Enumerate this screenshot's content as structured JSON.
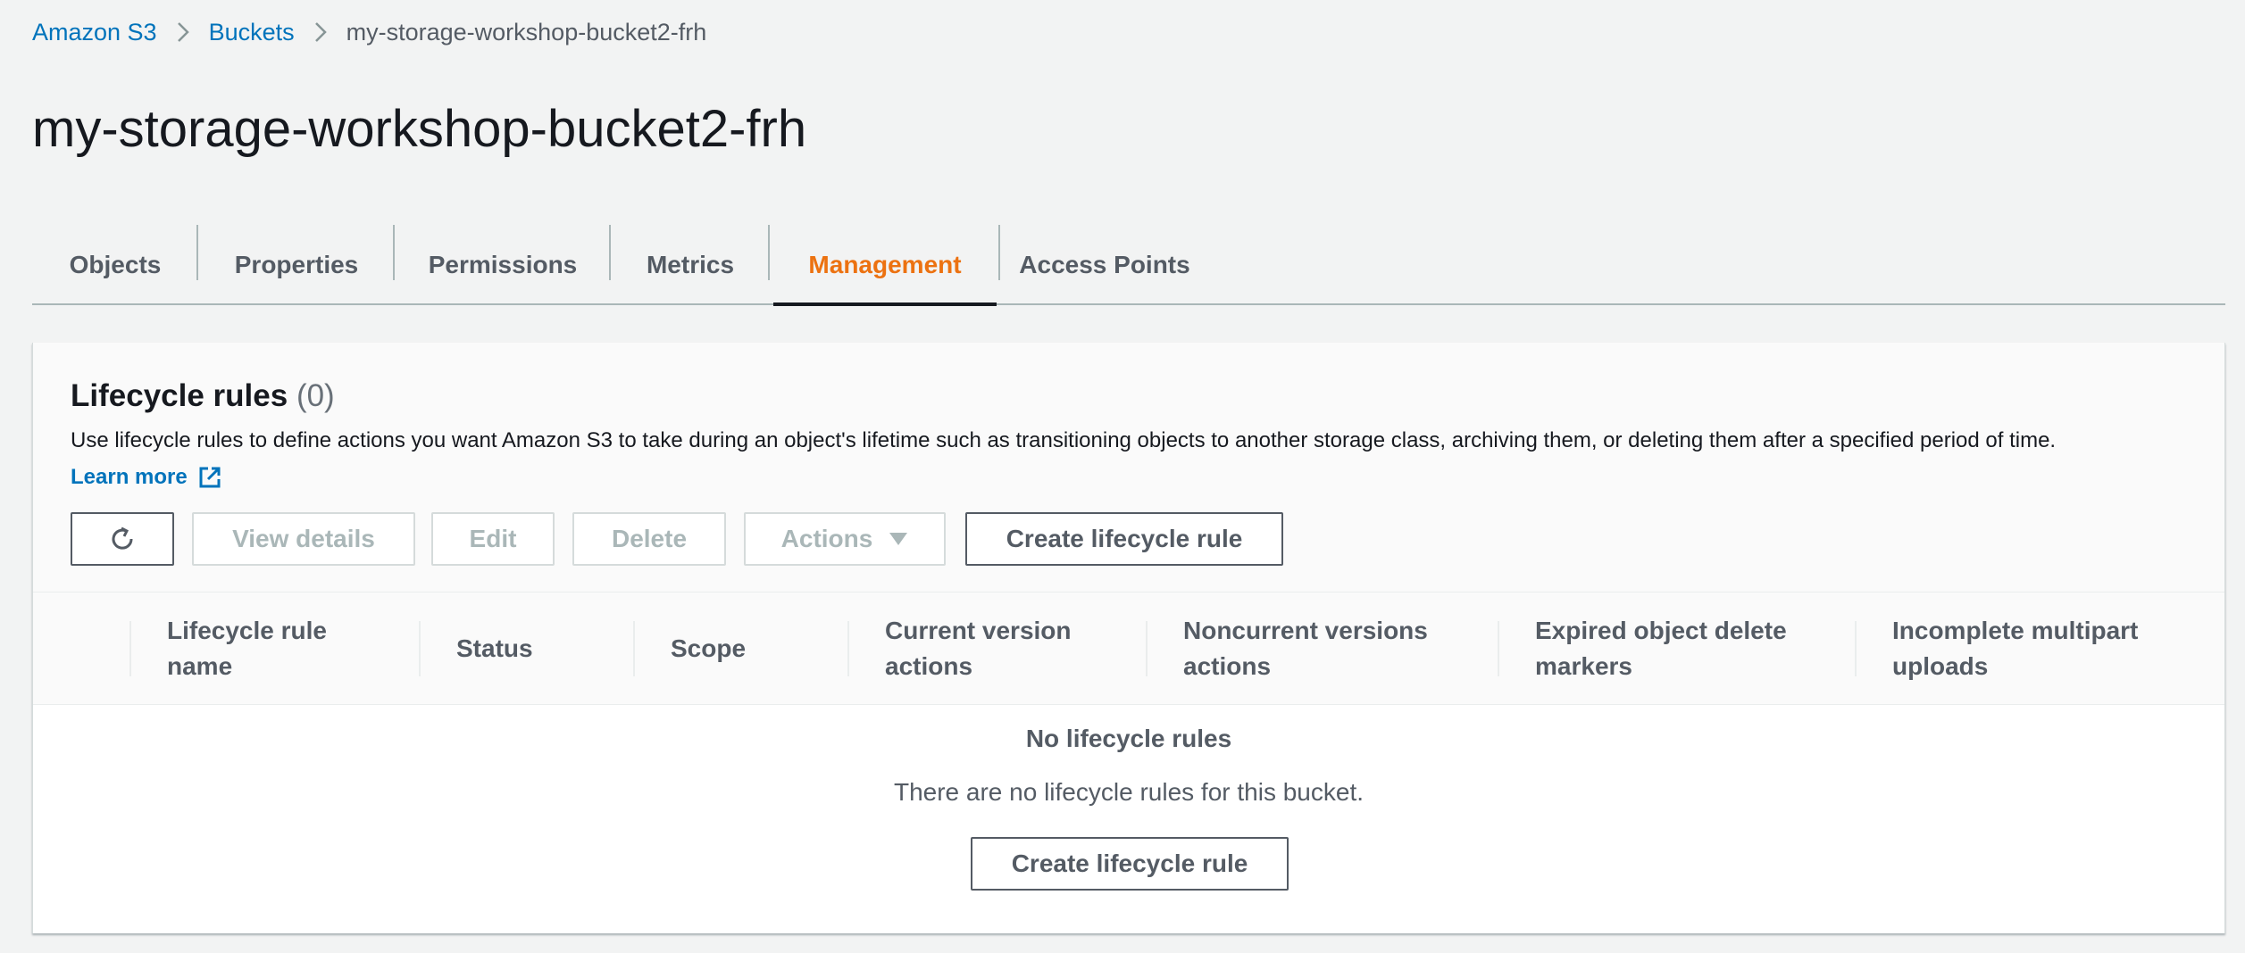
{
  "breadcrumb": {
    "items": [
      "Amazon S3",
      "Buckets"
    ],
    "current": "my-storage-workshop-bucket2-frh"
  },
  "page_title": "my-storage-workshop-bucket2-frh",
  "tabs": [
    {
      "label": "Objects"
    },
    {
      "label": "Properties"
    },
    {
      "label": "Permissions"
    },
    {
      "label": "Metrics"
    },
    {
      "label": "Management",
      "active": true
    },
    {
      "label": "Access Points"
    }
  ],
  "lifecycle": {
    "title": "Lifecycle rules",
    "count": "(0)",
    "description": "Use lifecycle rules to define actions you want Amazon S3 to take during an object's lifetime such as transitioning objects to another storage class, archiving them, or deleting them after a specified period of time.",
    "learn_more": "Learn more",
    "buttons": {
      "refresh_icon": "refresh-icon",
      "view_details": "View details",
      "edit": "Edit",
      "delete": "Delete",
      "actions": "Actions",
      "create": "Create lifecycle rule"
    },
    "columns": [
      "Lifecycle rule\nname",
      "Status",
      "Scope",
      "Current version\nactions",
      "Noncurrent versions\nactions",
      "Expired object delete\nmarkers",
      "Incomplete multipart\nuploads"
    ],
    "empty": {
      "title": "No lifecycle rules",
      "description": "There are no lifecycle rules for this bucket.",
      "button": "Create lifecycle rule"
    }
  },
  "colors": {
    "link": "#0073bb",
    "active_tab": "#ec7211",
    "background": "#f2f3f3"
  }
}
